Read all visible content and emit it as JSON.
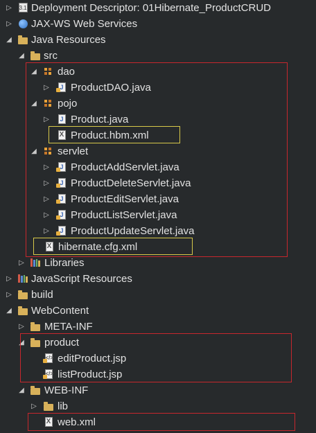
{
  "tree": {
    "deployment_descriptor": "Deployment Descriptor: 01Hibernate_ProductCRUD",
    "dd_badge": "3.1",
    "jaxws": "JAX-WS Web Services",
    "java_resources": "Java Resources",
    "src": "src",
    "dao": "dao",
    "product_dao": "ProductDAO.java",
    "pojo": "pojo",
    "product_java": "Product.java",
    "product_hbm": "Product.hbm.xml",
    "servlet": "servlet",
    "servlets": [
      "ProductAddServlet.java",
      "ProductDeleteServlet.java",
      "ProductEditServlet.java",
      "ProductListServlet.java",
      "ProductUpdateServlet.java"
    ],
    "hibernate_cfg": "hibernate.cfg.xml",
    "libraries": "Libraries",
    "javascript_resources": "JavaScript Resources",
    "build": "build",
    "webcontent": "WebContent",
    "meta_inf": "META-INF",
    "product_folder": "product",
    "edit_jsp": "editProduct.jsp",
    "list_jsp": "listProduct.jsp",
    "web_inf": "WEB-INF",
    "lib": "lib",
    "web_xml": "web.xml",
    "java_badge": "J",
    "xml_badge": "X"
  },
  "colors": {
    "background": "#272a2c",
    "text": "#e2e2e2",
    "highlight_red": "#c8272d",
    "highlight_yellow": "#d8c94a"
  }
}
